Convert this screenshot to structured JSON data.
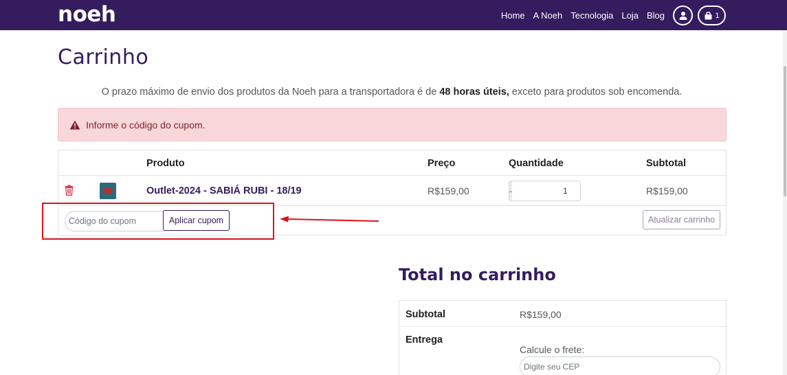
{
  "nav": {
    "logo": "noeh",
    "links": [
      "Home",
      "A Noeh",
      "Tecnologia",
      "Loja",
      "Blog"
    ],
    "cart_count": "1"
  },
  "page": {
    "title": "Carrinho",
    "notice_pre": "O prazo máximo de envio dos produtos da Noeh para a transportadora é de ",
    "notice_bold": "48 horas úteis,",
    "notice_post": " exceto para produtos sob encomenda."
  },
  "alert": {
    "text": "Informe o código do cupom."
  },
  "cart": {
    "headers": {
      "product": "Produto",
      "price": "Preço",
      "quantity": "Quantidade",
      "subtotal": "Subtotal"
    },
    "items": [
      {
        "name": "Outlet-2024 - SABIÁ RUBI - 18/19",
        "price": "R$159,00",
        "quantity": "1",
        "subtotal": "R$159,00"
      }
    ],
    "qty_minus": "-",
    "qty_plus": "+",
    "coupon_placeholder": "Código do cupom",
    "apply_coupon": "Aplicar cupom",
    "update_cart": "Atualizar carrinho"
  },
  "totals": {
    "title": "Total no carrinho",
    "subtotal_label": "Subtotal",
    "subtotal_value": "R$159,00",
    "shipping_label": "Entrega",
    "calc_shipping": "Calcule o frete:",
    "cep_placeholder": "Digite seu CEP"
  },
  "colors": {
    "brand": "#341c5f",
    "alert_bg": "#f8d7da",
    "alert_text": "#842029",
    "annotation": "#e0101c",
    "trash": "#dc3545"
  }
}
